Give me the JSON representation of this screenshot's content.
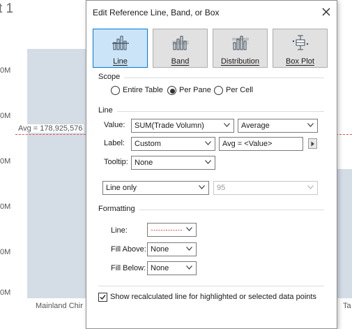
{
  "background": {
    "sheet_title": "t 1",
    "y_ticks": [
      "0M",
      "0M",
      "0M",
      "0M",
      "0M",
      "0M"
    ],
    "x_labels": [
      "Mainland Chir",
      "Ta"
    ],
    "reference_label": "Avg = 178,925,576",
    "colors": {
      "bar": "#d4dde6",
      "reference_line": "#e05252"
    }
  },
  "dialog": {
    "title": "Edit Reference Line, Band, or Box",
    "close_icon": "close-icon",
    "tabs": [
      {
        "label": "Line",
        "icon": "line-chart-icon",
        "active": true
      },
      {
        "label": "Band",
        "icon": "band-chart-icon",
        "active": false
      },
      {
        "label": "Distribution",
        "icon": "distribution-chart-icon",
        "active": false
      },
      {
        "label": "Box Plot",
        "icon": "box-plot-icon",
        "active": false
      }
    ],
    "scope": {
      "heading": "Scope",
      "options": [
        "Entire Table",
        "Per Pane",
        "Per Cell"
      ],
      "selected": "Per Pane"
    },
    "line": {
      "heading": "Line",
      "value_label": "Value:",
      "value_field": "SUM(Trade Volumn)",
      "aggregation": "Average",
      "label_label": "Label:",
      "label_type": "Custom",
      "label_text": "Avg = <Value>",
      "tooltip_label": "Tooltip:",
      "tooltip_value": "None",
      "display_mode": "Line only",
      "confidence": "95"
    },
    "formatting": {
      "heading": "Formatting",
      "line_label": "Line:",
      "line_color": "#e05252",
      "fill_above_label": "Fill Above:",
      "fill_above_value": "None",
      "fill_below_label": "Fill Below:",
      "fill_below_value": "None"
    },
    "show_recalculated": {
      "label": "Show recalculated line for highlighted or selected data points",
      "checked": true
    },
    "colors": {
      "active_tab_bg": "#cce4f7",
      "active_tab_border": "#0078d7"
    }
  }
}
